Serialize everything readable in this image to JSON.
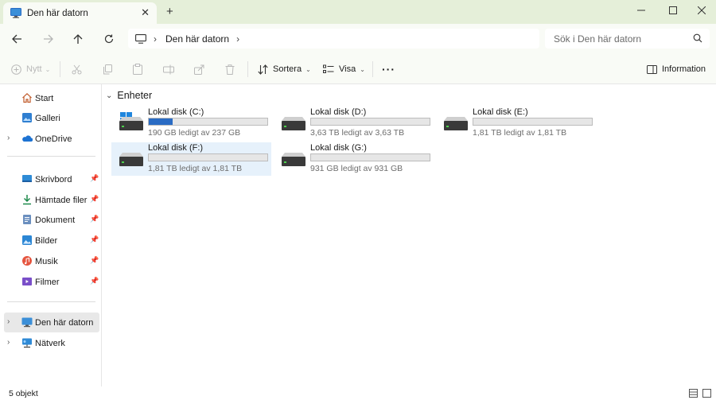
{
  "window": {
    "tab_title": "Den här datorn",
    "tab_icon": "computer-icon",
    "new_tab_glyph": "+",
    "close_glyph": "✕"
  },
  "navigation": {
    "breadcrumb": "Den här datorn",
    "search_placeholder": "Sök i Den här datorn"
  },
  "commands": {
    "new_label": "Nytt",
    "sort_label": "Sortera",
    "view_label": "Visa",
    "more_label": "···",
    "details_label": "Information"
  },
  "sidebar": {
    "items": [
      {
        "label": "Start",
        "icon": "home-icon"
      },
      {
        "label": "Galleri",
        "icon": "gallery-icon"
      },
      {
        "label": "OneDrive",
        "icon": "onedrive-icon"
      },
      {
        "label": "Skrivbord",
        "icon": "desktop-icon"
      },
      {
        "label": "Hämtade filer",
        "icon": "download-icon"
      },
      {
        "label": "Dokument",
        "icon": "document-icon"
      },
      {
        "label": "Bilder",
        "icon": "pictures-icon"
      },
      {
        "label": "Musik",
        "icon": "music-icon"
      },
      {
        "label": "Filmer",
        "icon": "videos-icon"
      },
      {
        "label": "Den här datorn",
        "icon": "computer-icon"
      },
      {
        "label": "Nätverk",
        "icon": "network-icon"
      }
    ]
  },
  "content": {
    "group_title": "Enheter",
    "drives": [
      {
        "name": "Lokal disk (C:)",
        "free_text": "190 GB ledigt av 237 GB",
        "used_fraction": 0.2,
        "system": true
      },
      {
        "name": "Lokal disk (D:)",
        "free_text": "3,63 TB ledigt av 3,63 TB",
        "used_fraction": 0.0
      },
      {
        "name": "Lokal disk (E:)",
        "free_text": "1,81 TB ledigt av 1,81 TB",
        "used_fraction": 0.0
      },
      {
        "name": "Lokal disk (F:)",
        "free_text": "1,81 TB ledigt av 1,81 TB",
        "used_fraction": 0.0,
        "selected": true
      },
      {
        "name": "Lokal disk (G:)",
        "free_text": "931 GB ledigt av 931 GB",
        "used_fraction": 0.0
      }
    ]
  },
  "status": {
    "item_count": "5 objekt"
  },
  "colors": {
    "accent": "#2a6cc4",
    "titlebar": "#e5efd9",
    "selection": "#e6f1fb"
  }
}
